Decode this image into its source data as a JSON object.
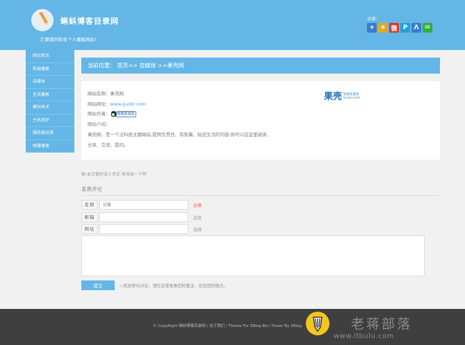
{
  "header": {
    "site_title": "蝌蚪博客目录网",
    "slogan": "汇聚国内知名个人播客网站!",
    "share_label": "分享：",
    "share_icons": [
      {
        "name": "plus-icon",
        "glyph": "+",
        "color": "#3a7ccc"
      },
      {
        "name": "star-icon",
        "glyph": "★",
        "color": "#e6a817"
      },
      {
        "name": "weibo-icon",
        "glyph": "微",
        "color": "#d9372a"
      },
      {
        "name": "p-icon",
        "glyph": "P",
        "color": "#22a0d8"
      },
      {
        "name": "lambda-icon",
        "glyph": "Λ",
        "color": "#3a7ccc"
      },
      {
        "name": "wechat-icon",
        "glyph": "✉",
        "color": "#35ad3a"
      }
    ],
    "accent_color": "#63b6e6"
  },
  "sidebar": {
    "items": [
      {
        "label": "网站首页"
      },
      {
        "label": "前端播客"
      },
      {
        "label": "自媒体"
      },
      {
        "label": "生活播客"
      },
      {
        "label": "建站技术"
      },
      {
        "label": "主机测评"
      },
      {
        "label": "服务器运维"
      },
      {
        "label": "网赚播客"
      }
    ]
  },
  "breadcrumb": {
    "text": "当前位置： 首页>> 自媒体 >>果壳网"
  },
  "site_info": {
    "name_label": "网站名称：",
    "name_value": "果壳网",
    "url_label": "网站网址：",
    "url_value": "www.guokr.com",
    "author_label": "网站作者：",
    "qq_badge": "给我发消息",
    "intro_label": "网站介绍：",
    "intro_text": "果壳网，是一个泛科技主题网站,提供负责任、有智囊、贴近生活的内容,你可以在这里阅读、",
    "intro_text2": "分享、交流、提问。",
    "logo_text": "果壳",
    "logo_sub1": "科技有意思",
    "logo_sub2": "Guokr.com"
  },
  "comments": {
    "hint": "额 本文暂时没人评论 来添加一个吧",
    "heading": "发表评论",
    "name_label": "名称",
    "name_placeholder": "访客",
    "name_note": "必填",
    "email_label": "邮箱",
    "email_note": "选填",
    "url_label": "网址",
    "url_note": "选填",
    "submit_label": "提交",
    "submit_hint": "☆欢迎参与讨论，请在这里发表您的看法、交流您的观点。"
  },
  "footer": {
    "copyright": "© CopyRight 蝌蚪博客目录网 / 关于我们 / Theme For ZBlog.Biz / Power By ZBlog",
    "watermark_title": "老蒋部落",
    "watermark_url": "www.itbulu.com"
  }
}
